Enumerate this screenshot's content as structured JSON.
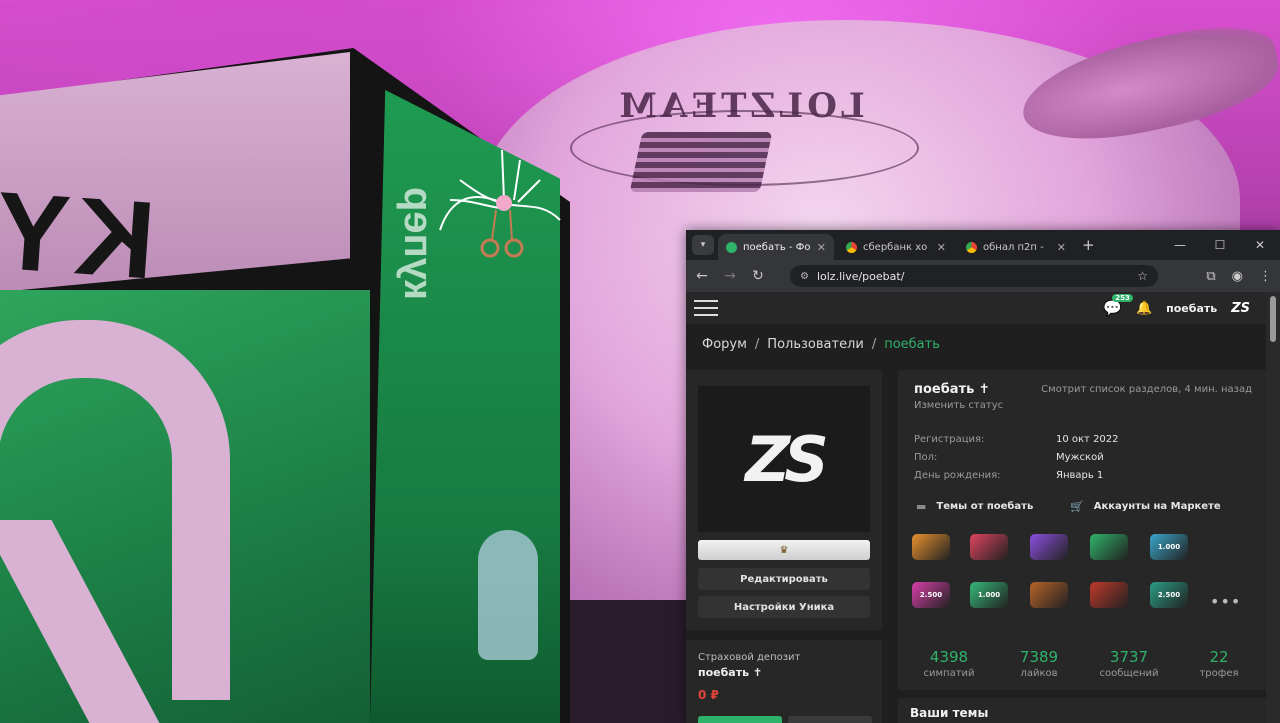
{
  "browser": {
    "tabs": [
      {
        "title": "поебать - Фо",
        "active": true,
        "favicon_color": "#2fb36a"
      },
      {
        "title": "сбербанк хо",
        "active": false,
        "favicon_color": "#4285f4"
      },
      {
        "title": "обнал п2п -",
        "active": false,
        "favicon_color": "#4285f4"
      }
    ],
    "url": "lolz.live/poebat/"
  },
  "site": {
    "chat_badge": "253",
    "header_user": "поебать",
    "breadcrumb": {
      "forum": "Форум",
      "users": "Пользователи",
      "current": "поебать",
      "separator": "/"
    }
  },
  "profile": {
    "username": "поебать",
    "status_link": "Изменить статус",
    "activity": "Смотрит список разделов, 4 мин. назад",
    "info": [
      {
        "label": "Регистрация:",
        "value": "10 окт 2022"
      },
      {
        "label": "Пол:",
        "value": "Мужской"
      },
      {
        "label": "День рождения:",
        "value": "Январь 1"
      }
    ],
    "links": {
      "threads": "Темы от поебать",
      "market": "Аккаунты на Маркете"
    },
    "buttons": {
      "edit": "Редактировать",
      "settings": "Настройки Уника"
    },
    "trophies": [
      {
        "label": "",
        "color": "#e8912f"
      },
      {
        "label": "",
        "color": "#e0445f"
      },
      {
        "label": "",
        "color": "#8c4fe0"
      },
      {
        "label": "",
        "color": "#2fb36a"
      },
      {
        "label": "1.000",
        "color": "#3aa6c9"
      },
      {
        "label": "2.500",
        "color": "#d83fa8"
      },
      {
        "label": "1.000",
        "color": "#36b87a"
      },
      {
        "label": "",
        "color": "#b8632a"
      },
      {
        "label": "",
        "color": "#c0392b"
      },
      {
        "label": "2.500",
        "color": "#2a9e85"
      }
    ],
    "stats": [
      {
        "value": "4398",
        "label": "симпатий"
      },
      {
        "value": "7389",
        "label": "лайков"
      },
      {
        "value": "3737",
        "label": "сообщений"
      },
      {
        "value": "22",
        "label": "трофея"
      }
    ]
  },
  "deposit": {
    "label": "Страховой депозит",
    "user": "поебать",
    "amount": "0 ₽"
  },
  "themes": {
    "title": "Ваши темы"
  },
  "photo": {
    "shirt_text": "LOLZTEAM",
    "bag_lid_text": "KY",
    "bag_side_text": "купер"
  },
  "colors": {
    "accent": "#2fb36a",
    "background": "#1f1f1f",
    "card": "#272727",
    "danger": "#e2443a"
  }
}
